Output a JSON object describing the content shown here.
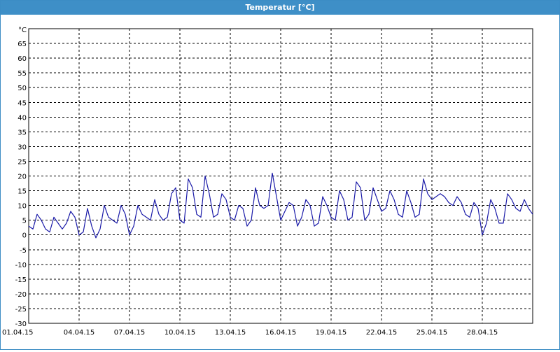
{
  "window": {
    "title": "Temperatur [°C]"
  },
  "chart_data": {
    "type": "line",
    "title": "Temperatur [°C]",
    "ylabel": "°C",
    "xlabel": "",
    "xlim": [
      "01.04.15",
      "01.05.15"
    ],
    "ylim": [
      -30,
      70
    ],
    "ytick_values": [
      -30,
      -25,
      -20,
      -15,
      -10,
      -5,
      0,
      5,
      10,
      15,
      20,
      25,
      30,
      35,
      40,
      45,
      50,
      55,
      60,
      65
    ],
    "xtick_labels": [
      "01.04.15",
      "04.04.15",
      "07.04.15",
      "10.04.15",
      "13.04.15",
      "16.04.15",
      "19.04.15",
      "22.04.15",
      "25.04.15",
      "28.04.15"
    ],
    "grid": true,
    "line_color": "#1a1aa8",
    "series": [
      {
        "name": "",
        "x": [
          "01.04.15 00:00",
          "01.04.15 06:00",
          "01.04.15 12:00",
          "01.04.15 18:00",
          "02.04.15 00:00",
          "02.04.15 06:00",
          "02.04.15 12:00",
          "02.04.15 18:00",
          "03.04.15 00:00",
          "03.04.15 06:00",
          "03.04.15 12:00",
          "03.04.15 18:00",
          "04.04.15 00:00",
          "04.04.15 06:00",
          "04.04.15 12:00",
          "04.04.15 18:00",
          "05.04.15 00:00",
          "05.04.15 06:00",
          "05.04.15 12:00",
          "05.04.15 18:00",
          "06.04.15 00:00",
          "06.04.15 06:00",
          "06.04.15 12:00",
          "06.04.15 18:00",
          "07.04.15 00:00",
          "07.04.15 06:00",
          "07.04.15 12:00",
          "07.04.15 18:00",
          "08.04.15 00:00",
          "08.04.15 06:00",
          "08.04.15 12:00",
          "08.04.15 18:00",
          "09.04.15 00:00",
          "09.04.15 06:00",
          "09.04.15 12:00",
          "09.04.15 18:00",
          "10.04.15 00:00",
          "10.04.15 06:00",
          "10.04.15 12:00",
          "10.04.15 18:00",
          "11.04.15 00:00",
          "11.04.15 06:00",
          "11.04.15 12:00",
          "11.04.15 18:00",
          "12.04.15 00:00",
          "12.04.15 06:00",
          "12.04.15 12:00",
          "12.04.15 18:00",
          "13.04.15 00:00",
          "13.04.15 06:00",
          "13.04.15 12:00",
          "13.04.15 18:00",
          "14.04.15 00:00",
          "14.04.15 06:00",
          "14.04.15 12:00",
          "14.04.15 18:00",
          "15.04.15 00:00",
          "15.04.15 06:00",
          "15.04.15 12:00",
          "15.04.15 18:00",
          "16.04.15 00:00",
          "16.04.15 06:00",
          "16.04.15 12:00",
          "16.04.15 18:00",
          "17.04.15 00:00",
          "17.04.15 06:00",
          "17.04.15 12:00",
          "17.04.15 18:00",
          "18.04.15 00:00",
          "18.04.15 06:00",
          "18.04.15 12:00",
          "18.04.15 18:00",
          "19.04.15 00:00",
          "19.04.15 06:00",
          "19.04.15 12:00",
          "19.04.15 18:00",
          "20.04.15 00:00",
          "20.04.15 06:00",
          "20.04.15 12:00",
          "20.04.15 18:00",
          "21.04.15 00:00",
          "21.04.15 06:00",
          "21.04.15 12:00",
          "21.04.15 18:00",
          "22.04.15 00:00",
          "22.04.15 06:00",
          "22.04.15 12:00",
          "22.04.15 18:00",
          "23.04.15 00:00",
          "23.04.15 06:00",
          "23.04.15 12:00",
          "23.04.15 18:00",
          "24.04.15 00:00",
          "24.04.15 06:00",
          "24.04.15 12:00",
          "24.04.15 18:00",
          "25.04.15 00:00",
          "25.04.15 06:00",
          "25.04.15 12:00",
          "25.04.15 18:00",
          "26.04.15 00:00",
          "26.04.15 06:00",
          "26.04.15 12:00",
          "26.04.15 18:00",
          "27.04.15 00:00",
          "27.04.15 06:00",
          "27.04.15 12:00",
          "27.04.15 18:00",
          "28.04.15 00:00",
          "28.04.15 06:00",
          "28.04.15 12:00",
          "28.04.15 18:00",
          "29.04.15 00:00",
          "29.04.15 06:00",
          "29.04.15 12:00",
          "29.04.15 18:00",
          "30.04.15 00:00",
          "30.04.15 06:00",
          "30.04.15 12:00",
          "30.04.15 18:00",
          "01.05.15 00:00"
        ],
        "y": [
          3,
          2,
          7,
          5,
          2,
          1,
          6,
          4,
          2,
          4,
          8,
          6,
          0,
          1,
          9,
          3,
          -1,
          2,
          10,
          6,
          5,
          4,
          10,
          7,
          0,
          3,
          10,
          7,
          6,
          5,
          12,
          7,
          5,
          6,
          14,
          16,
          5,
          4,
          19,
          16,
          7,
          6,
          20,
          14,
          6,
          7,
          14,
          12,
          6,
          5,
          10,
          9,
          3,
          5,
          16,
          10,
          9,
          10,
          21,
          13,
          5,
          8,
          11,
          10,
          3,
          6,
          12,
          10,
          3,
          4,
          13,
          10,
          6,
          5,
          15,
          12,
          5,
          6,
          18,
          16,
          5,
          7,
          16,
          12,
          8,
          9,
          15,
          12,
          7,
          6,
          15,
          11,
          6,
          7,
          19,
          14,
          12,
          13,
          14,
          13,
          11,
          10,
          13,
          11,
          7,
          6,
          11,
          9,
          0,
          4,
          12,
          9,
          4,
          4,
          14,
          12,
          9,
          8,
          12,
          9,
          7
        ]
      }
    ]
  }
}
